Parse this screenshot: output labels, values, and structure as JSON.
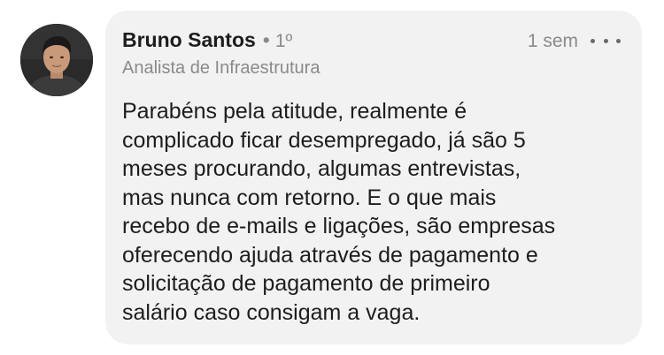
{
  "comment": {
    "author": {
      "name": "Bruno Santos",
      "separator": "•",
      "degree": "1º",
      "headline": "Analista de Infraestrutura",
      "avatar_icon": "profile-photo"
    },
    "time_ago": "1 sem",
    "more_icon": "ellipsis-horizontal-icon",
    "body_lines": [
      "Parabéns pela atitude, realmente é",
      "complicado ficar desempregado, já são 5",
      "meses procurando, algumas entrevistas,",
      "mas nunca com retorno. E o que mais",
      "recebo de e-mails e ligações, são empresas",
      "oferecendo ajuda através de pagamento e",
      "solicitação de pagamento de primeiro",
      "salário caso consigam a vaga."
    ]
  },
  "colors": {
    "bubble_background": "#f2f2f2",
    "primary_text": "#1d1d1d",
    "secondary_text": "#8a8a8a"
  }
}
